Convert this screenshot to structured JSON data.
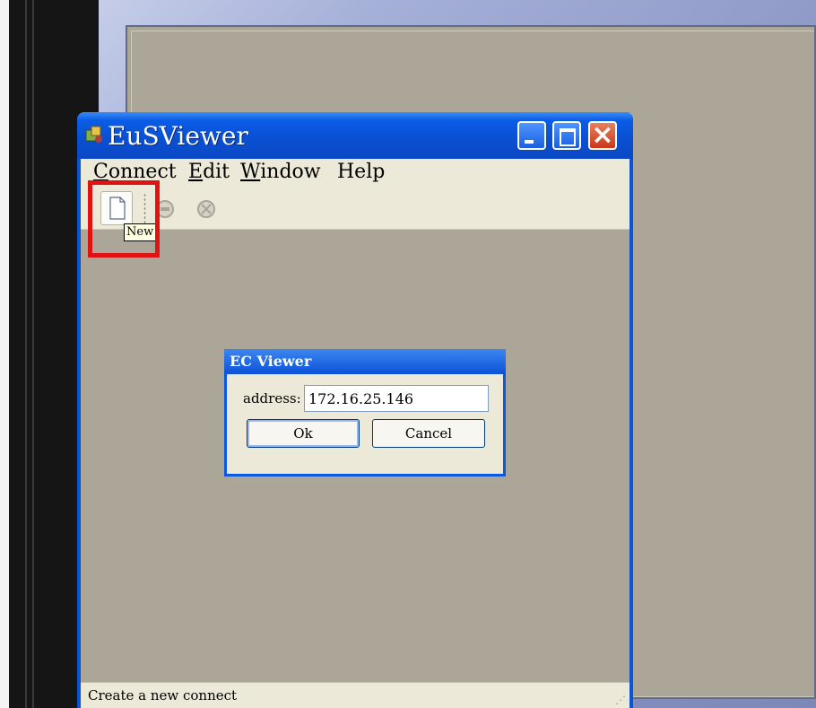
{
  "app": {
    "title": "EuSViewer",
    "menu": [
      {
        "label": "Connect"
      },
      {
        "label": "Edit"
      },
      {
        "label": "Window"
      },
      {
        "label": "Help"
      }
    ],
    "toolbar": {
      "new_tooltip": "New"
    },
    "status": "Create a new connect"
  },
  "dialog": {
    "title": "EC Viewer",
    "address_label": "address:",
    "address_value": "172.16.25.146",
    "ok_label": "Ok",
    "cancel_label": "Cancel"
  },
  "icons": {
    "app_icon": "app-icon",
    "new": "new-document-icon",
    "connect": "connect-icon",
    "disconnect": "disconnect-icon"
  },
  "colors": {
    "title_bar": "#0a54d6",
    "client_background": "#aba697",
    "highlight_box": "#e01212"
  }
}
